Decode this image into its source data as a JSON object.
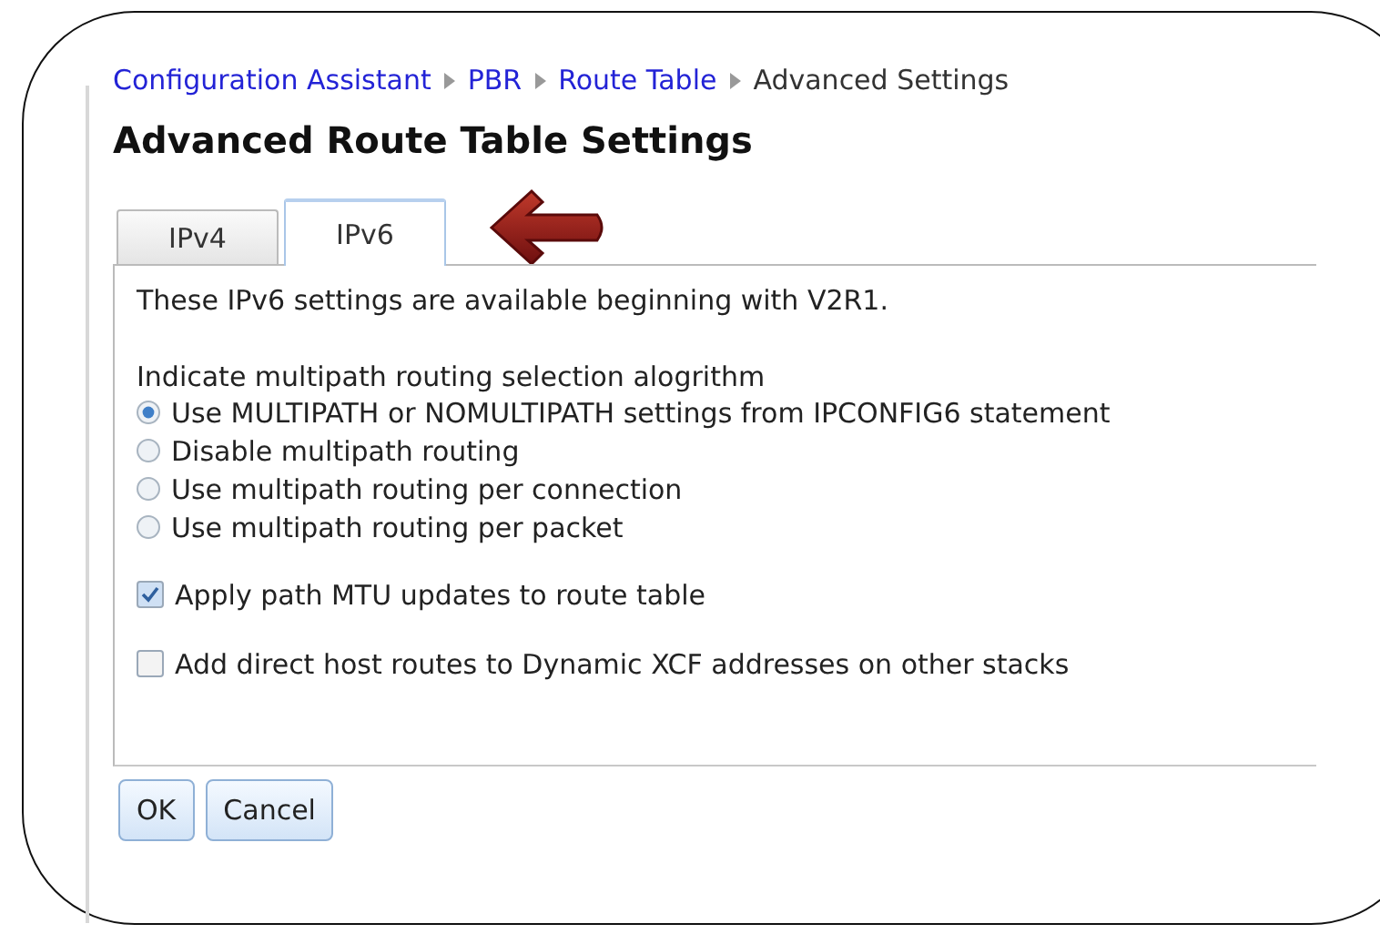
{
  "breadcrumb": [
    {
      "label": "Configuration Assistant",
      "kind": "link"
    },
    {
      "label": "PBR",
      "kind": "link"
    },
    {
      "label": "Route Table",
      "kind": "link"
    },
    {
      "label": "Advanced Settings",
      "kind": "current"
    }
  ],
  "title": "Advanced Route Table Settings",
  "tabs": [
    {
      "label": "IPv4",
      "selected": false
    },
    {
      "label": "IPv6",
      "selected": true
    }
  ],
  "intro": "These IPv6 settings are available beginning with V2R1.",
  "radio_group": {
    "label": "Indicate multipath routing selection alogrithm",
    "options": [
      {
        "label": "Use MULTIPATH or NOMULTIPATH settings from IPCONFIG6 statement",
        "selected": true
      },
      {
        "label": "Disable multipath routing",
        "selected": false
      },
      {
        "label": "Use multipath routing per connection",
        "selected": false
      },
      {
        "label": "Use multipath routing per packet",
        "selected": false
      }
    ]
  },
  "checkboxes": [
    {
      "label": "Apply path MTU updates to route table",
      "checked": true
    },
    {
      "label": "Add direct host routes to Dynamic XCF addresses on other stacks",
      "checked": false
    }
  ],
  "buttons": [
    "OK",
    "Cancel"
  ]
}
